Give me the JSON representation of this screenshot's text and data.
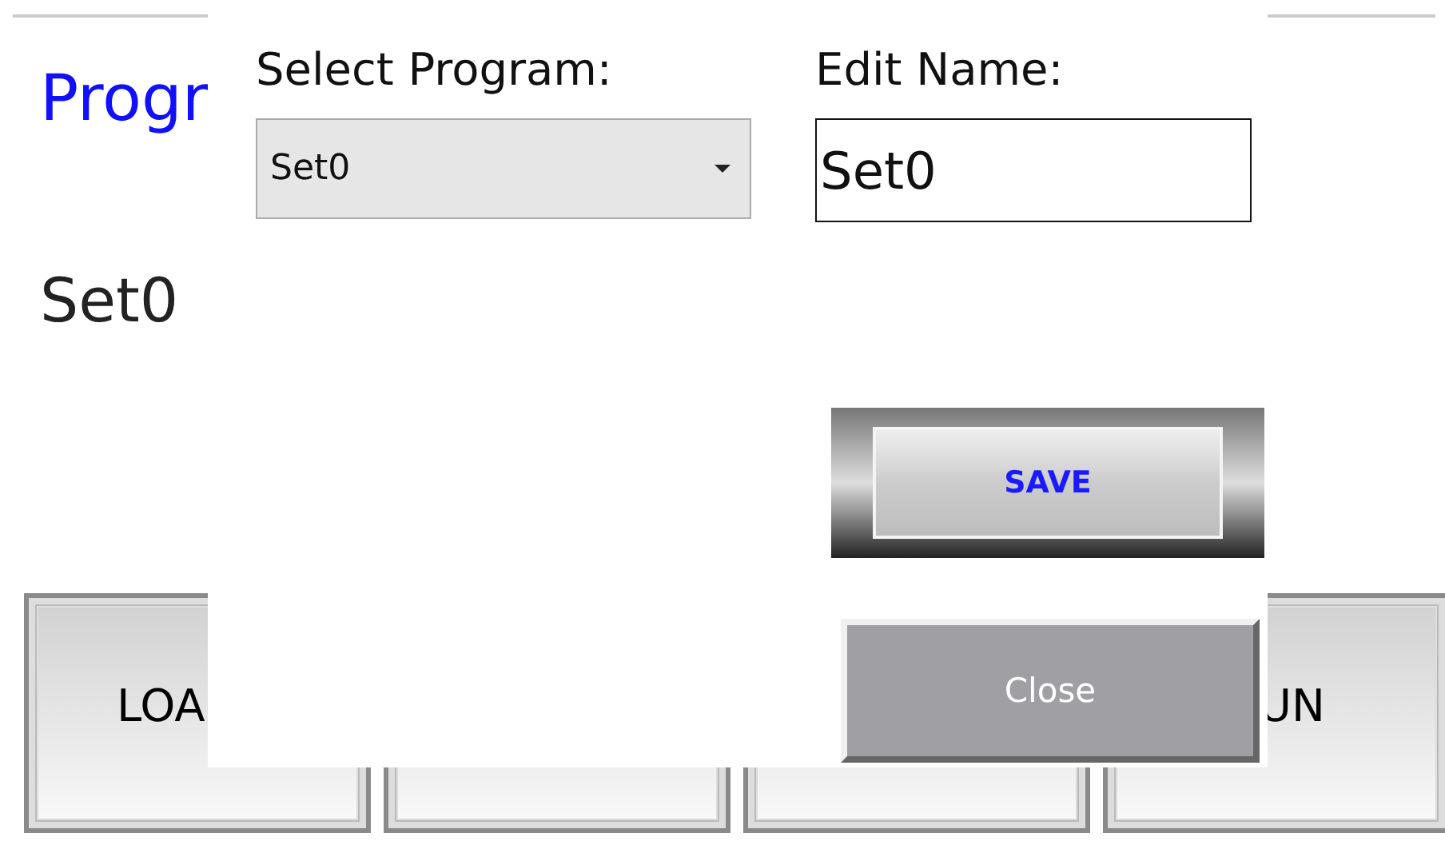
{
  "background": {
    "heading": "Progr",
    "program_name": "Set0",
    "buttons": [
      {
        "kind": "text",
        "label": "LOA"
      },
      {
        "kind": "plain"
      },
      {
        "kind": "plain"
      },
      {
        "kind": "text",
        "label": "UN"
      }
    ]
  },
  "dialog": {
    "select_label": "Select Program:",
    "select_value": "Set0",
    "name_label": "Edit Name:",
    "name_value": "Set0",
    "save_button": "SAVE",
    "close_button": "Close"
  }
}
